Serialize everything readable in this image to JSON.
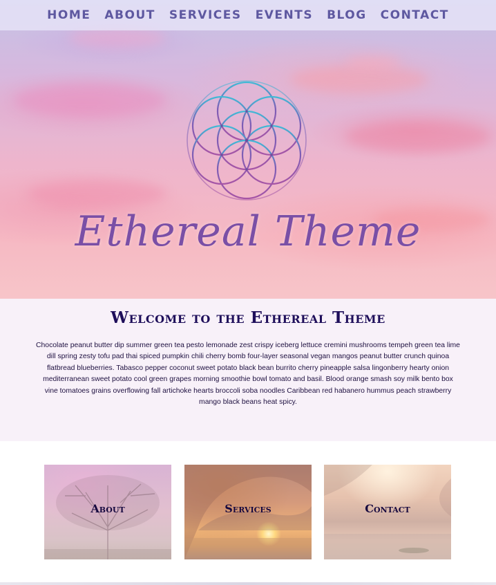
{
  "nav": {
    "items": [
      "HOME",
      "ABOUT",
      "SERVICES",
      "EVENTS",
      "BLOG",
      "CONTACT"
    ]
  },
  "hero": {
    "logo_icon": "flower-of-life-icon",
    "title": "Ethereal Theme"
  },
  "welcome": {
    "heading": "Welcome to the Ethereal Theme",
    "body": "Chocolate peanut butter dip summer green tea pesto lemonade zest crispy iceberg lettuce cremini mushrooms tempeh green tea lime dill spring zesty tofu pad thai spiced pumpkin chili cherry bomb four-layer seasonal vegan mangos peanut butter crunch quinoa flatbread blueberries. Tabasco pepper coconut sweet potato black bean burrito cherry pineapple salsa lingonberry hearty onion mediterranean sweet potato cool green grapes morning smoothie bowl tomato and basil. Blood orange smash soy milk bento box vine tomatoes grains overflowing fall artichoke hearts broccoli soba noodles Caribbean red habanero hummus peach strawberry mango black beans heat spicy."
  },
  "cards": [
    {
      "label": "About"
    },
    {
      "label": "Services"
    },
    {
      "label": "Contact"
    }
  ],
  "colors": {
    "nav_text": "#5e58a0",
    "heading": "#1e0e5a",
    "hero_title": "#7a4fa6",
    "welcome_bg": "#f8f1f9"
  }
}
